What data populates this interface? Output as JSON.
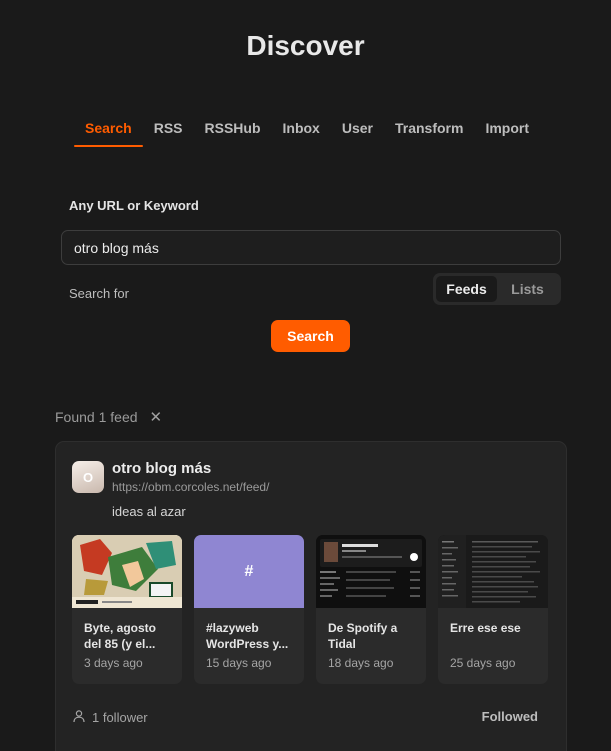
{
  "page": {
    "title": "Discover"
  },
  "tabs": [
    {
      "label": "Search",
      "active": true
    },
    {
      "label": "RSS"
    },
    {
      "label": "RSSHub"
    },
    {
      "label": "Inbox"
    },
    {
      "label": "User"
    },
    {
      "label": "Transform"
    },
    {
      "label": "Import"
    }
  ],
  "form": {
    "label": "Any URL or Keyword",
    "value": "otro blog más",
    "search_for_label": "Search for",
    "segments": [
      "Feeds",
      "Lists"
    ],
    "search_button": "Search"
  },
  "results": {
    "found_text": "Found 1 feed",
    "close_glyph": "✕"
  },
  "feed": {
    "avatar_letter": "O",
    "title": "otro blog más",
    "url": "https://obm.corcoles.net/feed/",
    "description": "ideas al azar",
    "entries": [
      {
        "title": "Byte, agosto del 85 (y el...",
        "date": "3 days ago"
      },
      {
        "title": "#lazyweb WordPress y...",
        "date": "15 days ago",
        "thumb_text": "#"
      },
      {
        "title": "De Spotify a Tidal",
        "date": "18 days ago"
      },
      {
        "title": "Erre ese ese",
        "date": "25 days ago"
      }
    ],
    "followers": "1 follower",
    "followed_label": "Followed"
  },
  "colors": {
    "accent": "#ff5c00",
    "background": "#1a1a1a",
    "card": "#232323"
  }
}
